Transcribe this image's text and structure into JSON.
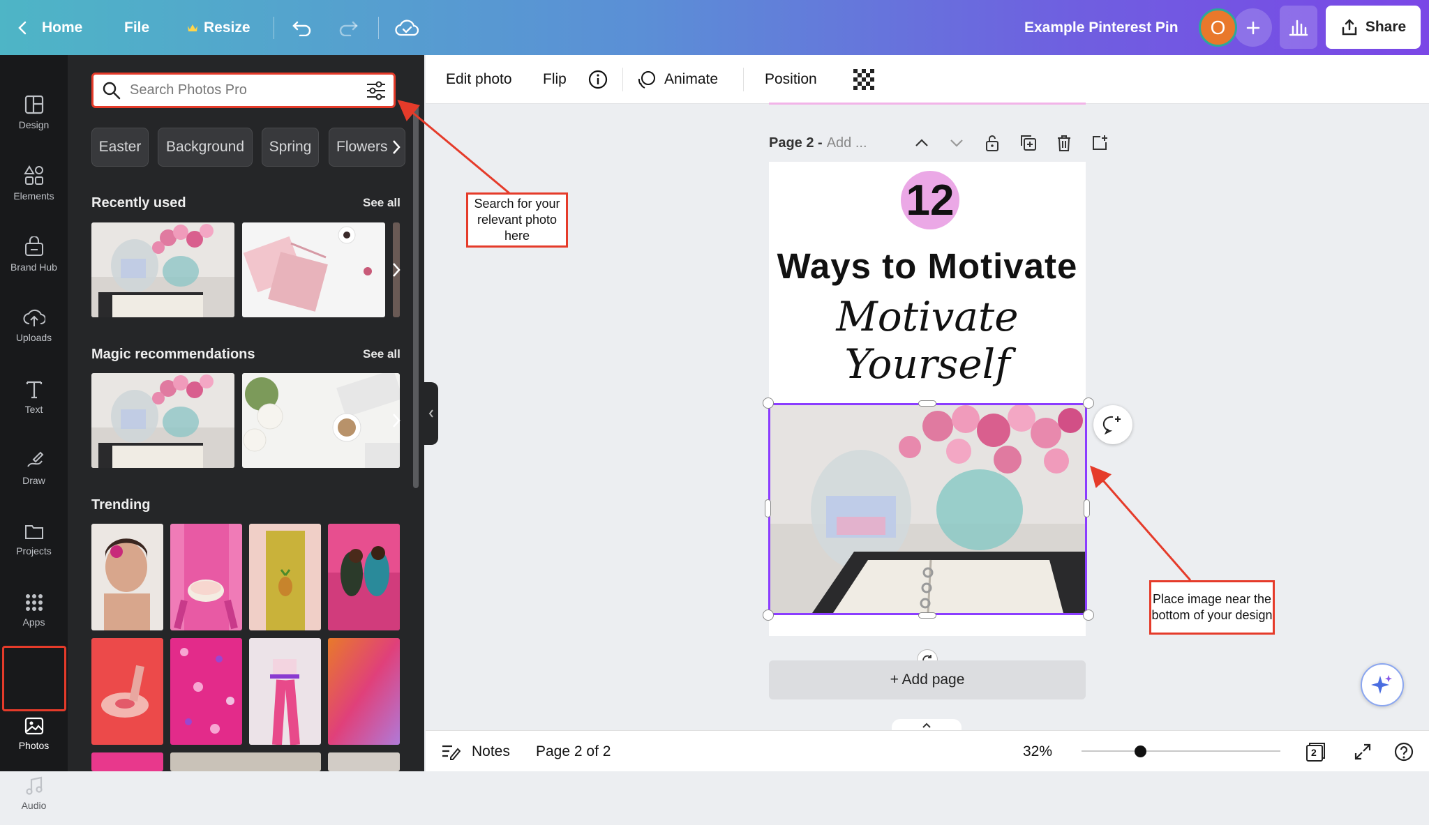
{
  "topbar": {
    "home": "Home",
    "file": "File",
    "resize": "Resize",
    "doc_title": "Example Pinterest Pin",
    "avatar_initial": "O",
    "share": "Share"
  },
  "rail": {
    "items": [
      {
        "label": "Design",
        "icon": "layout-icon"
      },
      {
        "label": "Elements",
        "icon": "shapes-icon"
      },
      {
        "label": "Brand Hub",
        "icon": "brand-icon"
      },
      {
        "label": "Uploads",
        "icon": "cloud-upload-icon"
      },
      {
        "label": "Text",
        "icon": "text-icon"
      },
      {
        "label": "Draw",
        "icon": "draw-icon"
      },
      {
        "label": "Projects",
        "icon": "folder-icon"
      },
      {
        "label": "Apps",
        "icon": "grid-icon"
      },
      {
        "label": "Photos",
        "icon": "image-icon"
      },
      {
        "label": "Audio",
        "icon": "music-icon"
      }
    ],
    "active": "Photos"
  },
  "panel": {
    "search_placeholder": "Search Photos Pro",
    "chips": [
      "Easter",
      "Background",
      "Spring",
      "Flowers"
    ],
    "recently_used": "Recently used",
    "magic_recommendations": "Magic recommendations",
    "trending": "Trending",
    "see_all": "See all"
  },
  "context_toolbar": {
    "edit_photo": "Edit photo",
    "flip": "Flip",
    "animate": "Animate",
    "position": "Position"
  },
  "canvas": {
    "page_label": "Page 2 -",
    "page_title_placeholder": "Add ...",
    "number": "12",
    "headline": "Ways to Motivate",
    "script_line": "Motivate Yourself",
    "add_page": "+ Add page"
  },
  "annotations": {
    "search_note": "Search for your relevant photo here",
    "place_note": "Place image near the bottom of your design"
  },
  "bottombar": {
    "notes": "Notes",
    "page_indicator": "Page 2 of 2",
    "zoom": "32%",
    "page_count": "2",
    "zoom_level_fraction": 0.32
  },
  "colors": {
    "accent_purple": "#8b3dff",
    "annotation_red": "#e53b2a",
    "pink_circle": "#eba8e6"
  }
}
